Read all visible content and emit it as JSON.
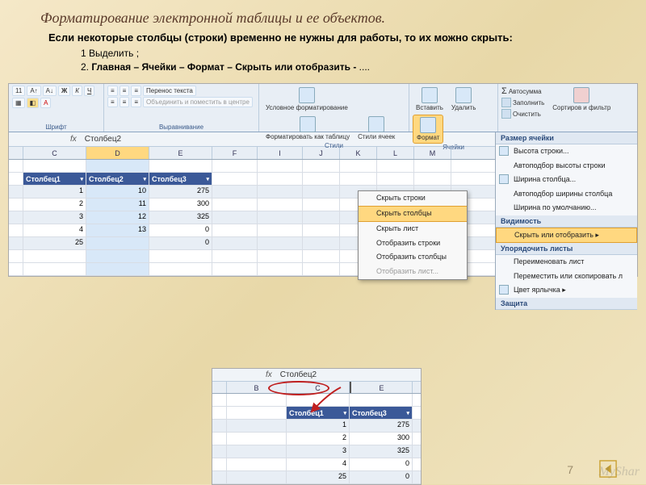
{
  "title": "Форматирование электронной таблицы и ее объектов.",
  "description": "Если некоторые столбцы (строки) временно не нужны для работы, то их можно скрыть:",
  "step1": "1 Выделить ;",
  "step2_prefix": "2. ",
  "step2_bold": "Главная – Ячейки – Формат – Скрыть или отобразить - ",
  "step2_suffix": "....",
  "ribbon": {
    "font_size": "11",
    "font_group": "Шрифт",
    "align_group": "Выравнивание",
    "wrap": "Перенос текста",
    "merge": "Объединить и поместить в центре",
    "styles_group": "Стили",
    "cond": "Условное форматирование",
    "astable": "Форматировать как таблицу",
    "cellstyles": "Стили ячеек",
    "cells_group": "Ячейки",
    "insert": "Вставить",
    "delete": "Удалить",
    "format": "Формат"
  },
  "right_panel": {
    "autosum": "Автосумма",
    "fill": "Заполнить",
    "clear": "Очистить",
    "sort": "Сортиров и фильтр"
  },
  "format_menu": {
    "head1": "Размер ячейки",
    "i1": "Высота строки...",
    "i2": "Автоподбор высоты строки",
    "i3": "Ширина столбца...",
    "i4": "Автоподбор ширины столбца",
    "i5": "Ширина по умолчанию...",
    "head2": "Видимость",
    "i6": "Скрыть или отобразить",
    "head3": "Упорядочить листы",
    "i7": "Переименовать лист",
    "i8": "Переместить или скопировать л",
    "i9": "Цвет ярлычка",
    "head4": "Защита"
  },
  "ctx": {
    "i1": "Скрыть строки",
    "i2": "Скрыть столбцы",
    "i3": "Скрыть лист",
    "i4": "Отобразить строки",
    "i5": "Отобразить столбцы",
    "i6": "Отобразить лист..."
  },
  "fx_value": "Столбец2",
  "cols_main": [
    "C",
    "D",
    "E",
    "F",
    "I",
    "J",
    "K",
    "L",
    "M"
  ],
  "table_headers": [
    "Столбец1",
    "Столбец2",
    "Столбец3"
  ],
  "rows_main": [
    [
      "1",
      "10",
      "275"
    ],
    [
      "2",
      "11",
      "300"
    ],
    [
      "3",
      "12",
      "325"
    ],
    [
      "4",
      "13",
      "0"
    ],
    [
      "25",
      "",
      "0"
    ]
  ],
  "fx_value2": "Столбец2",
  "cols_small": [
    "B",
    "C",
    "E"
  ],
  "table_headers_small": [
    "Столбец1",
    "Столбец3"
  ],
  "rows_small": [
    [
      "1",
      "275"
    ],
    [
      "2",
      "300"
    ],
    [
      "3",
      "325"
    ],
    [
      "4",
      "0"
    ],
    [
      "25",
      "0"
    ]
  ],
  "page_number": "7",
  "watermark": "MyShar"
}
